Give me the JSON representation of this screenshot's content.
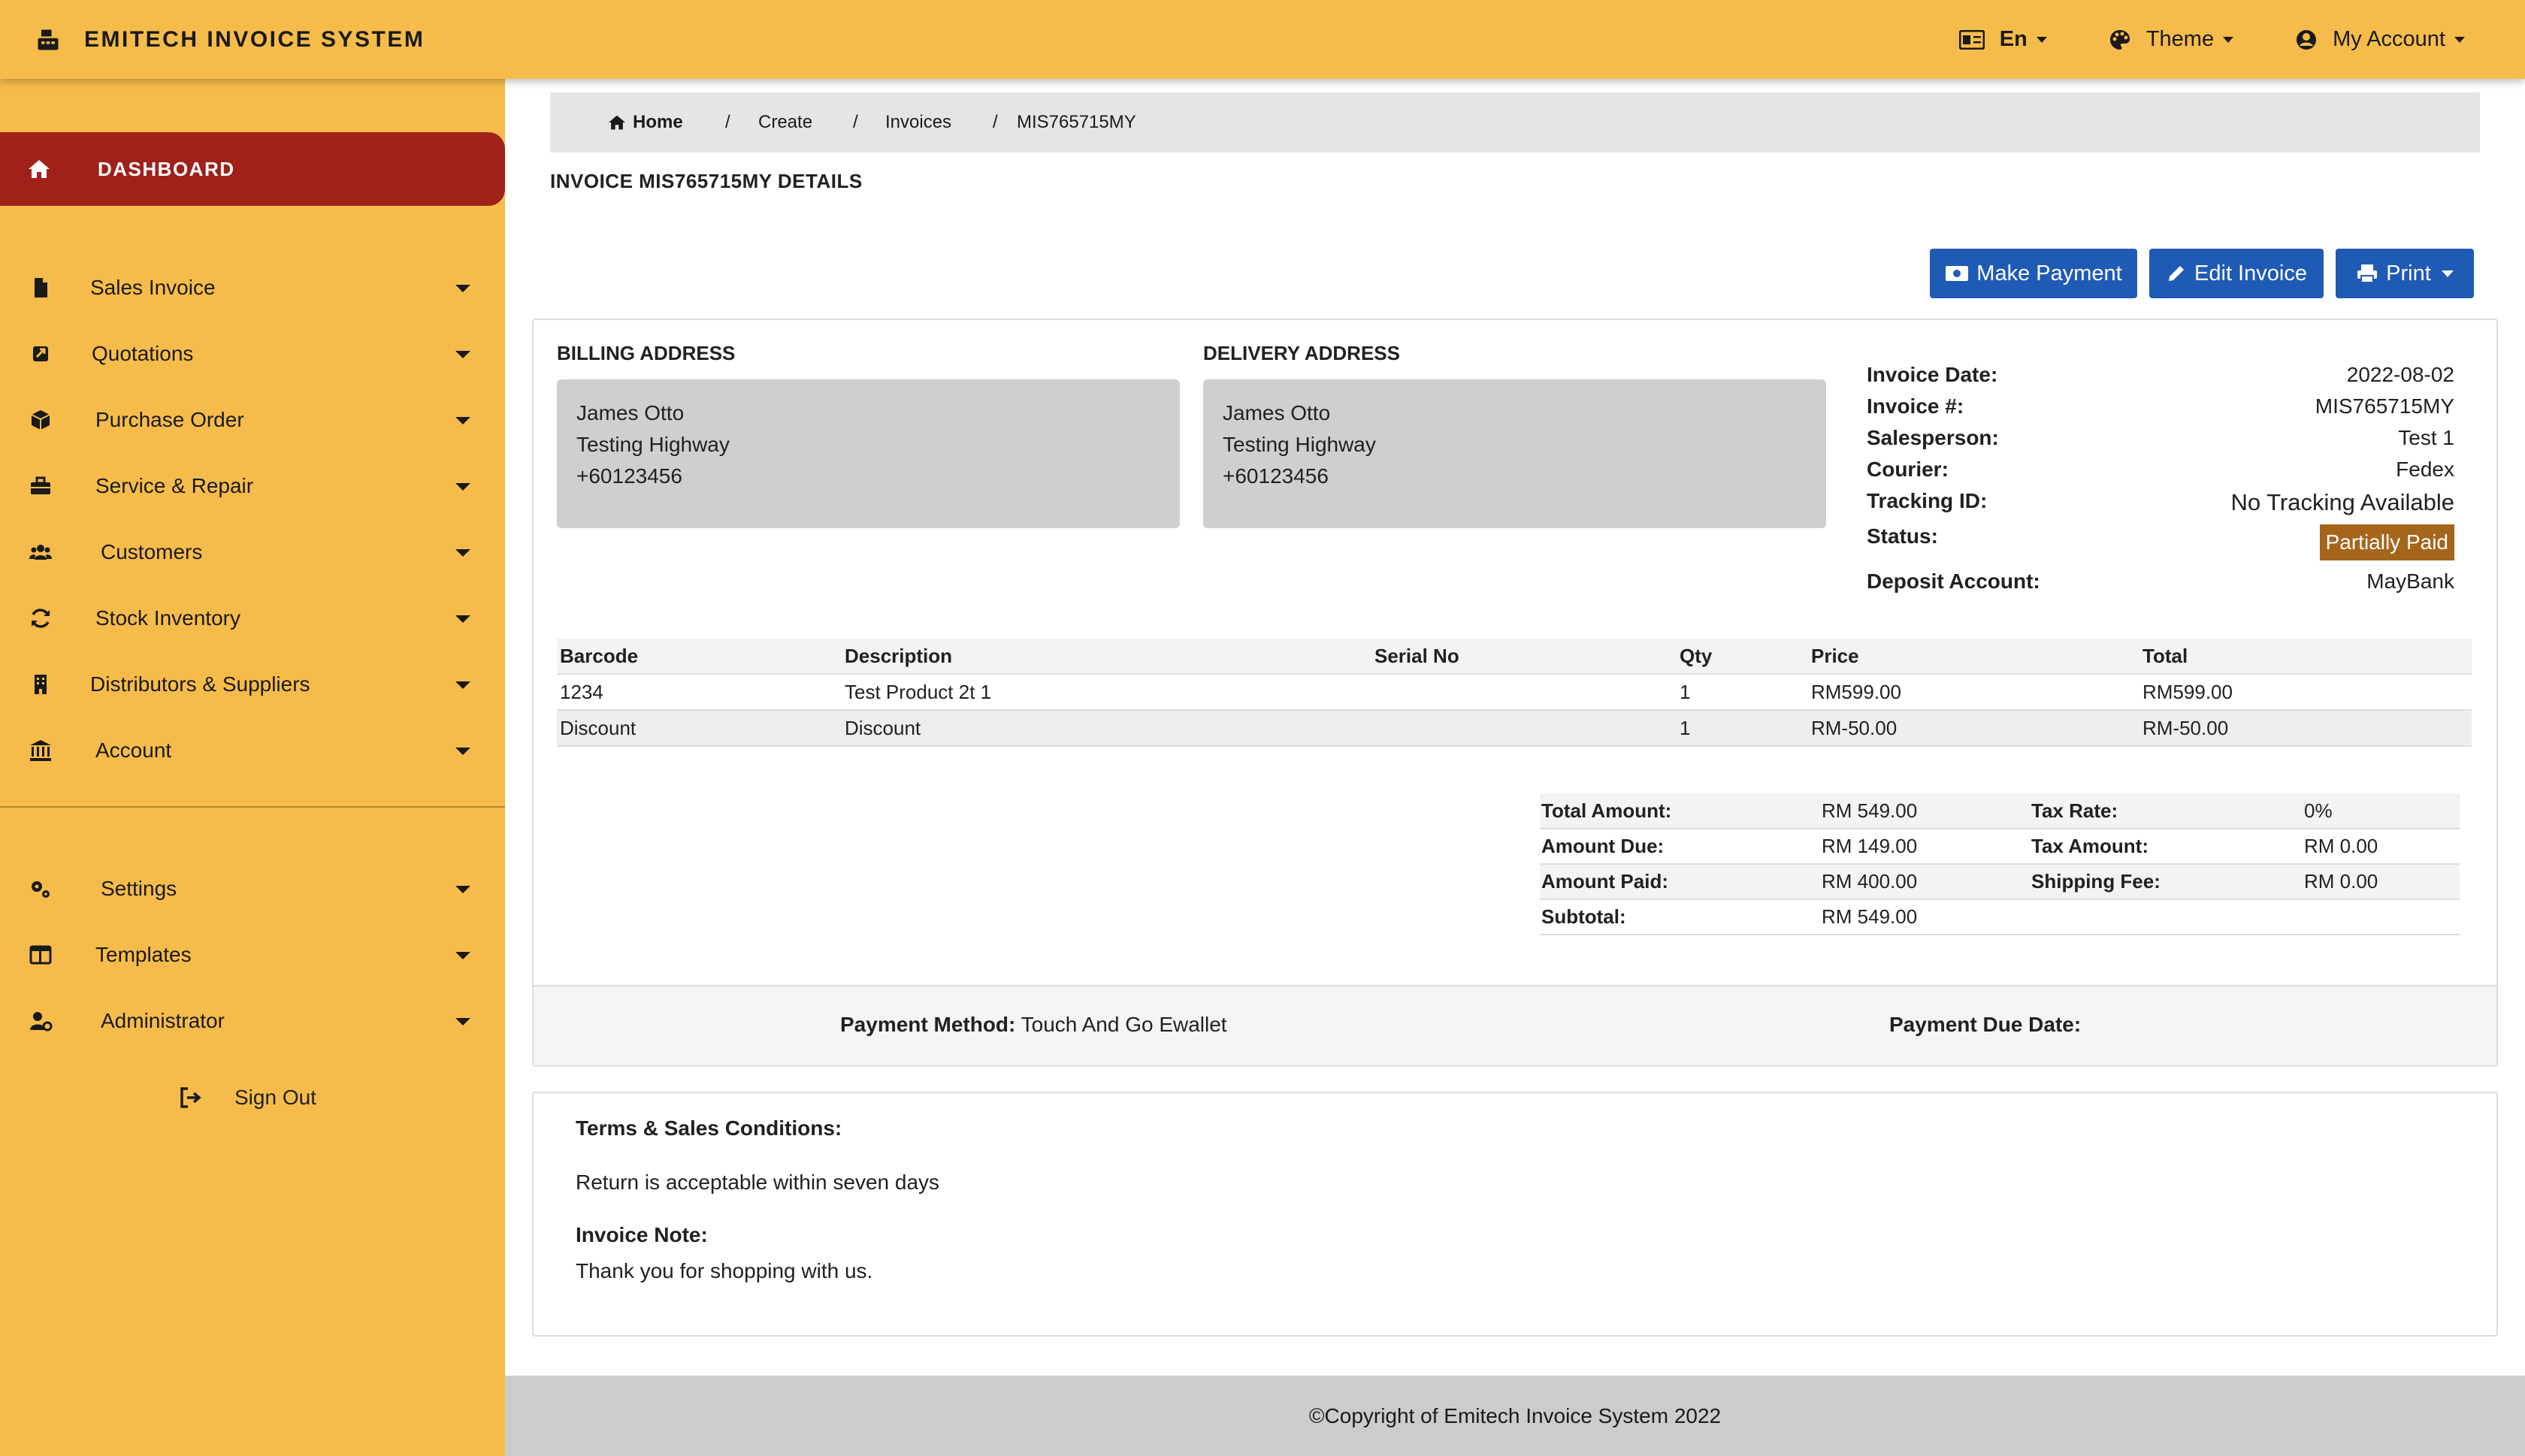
{
  "app": {
    "title": "EMITECH INVOICE SYSTEM"
  },
  "topbar": {
    "language": "En",
    "theme": "Theme",
    "account": "My Account"
  },
  "sidebar": {
    "dashboard": "DASHBOARD",
    "items": [
      {
        "label": "Sales Invoice",
        "icon": "file-icon"
      },
      {
        "label": "Quotations",
        "icon": "quote-icon"
      },
      {
        "label": "Purchase Order",
        "icon": "box-icon"
      },
      {
        "label": "Service & Repair",
        "icon": "toolbox-icon"
      },
      {
        "label": "Customers",
        "icon": "users-icon"
      },
      {
        "label": "Stock Inventory",
        "icon": "sync-icon"
      },
      {
        "label": "Distributors & Suppliers",
        "icon": "building-icon"
      },
      {
        "label": "Account",
        "icon": "bank-icon"
      },
      {
        "label": "Settings",
        "icon": "gears-icon"
      },
      {
        "label": "Templates",
        "icon": "layout-icon"
      },
      {
        "label": "Administrator",
        "icon": "user-cog-icon"
      }
    ],
    "signout": "Sign Out"
  },
  "breadcrumb": {
    "home": "Home",
    "sep": "/",
    "create": "Create",
    "invoices": "Invoices",
    "current": "MIS765715MY"
  },
  "page": {
    "title": "INVOICE MIS765715MY DETAILS"
  },
  "actions": {
    "make_payment": "Make Payment",
    "edit_invoice": "Edit Invoice",
    "print": "Print"
  },
  "billing": {
    "heading": "BILLING ADDRESS",
    "name": "James Otto",
    "street": "Testing Highway",
    "phone": "+60123456"
  },
  "delivery": {
    "heading": "DELIVERY ADDRESS",
    "name": "James Otto",
    "street": "Testing Highway",
    "phone": "+60123456"
  },
  "meta": {
    "invoice_date_label": "Invoice Date:",
    "invoice_date": "2022-08-02",
    "invoice_no_label": "Invoice #:",
    "invoice_no": "MIS765715MY",
    "salesperson_label": "Salesperson:",
    "salesperson": "Test 1",
    "courier_label": "Courier:",
    "courier": "Fedex",
    "tracking_label": "Tracking ID:",
    "tracking": "No Tracking Available",
    "status_label": "Status:",
    "status": "Partially Paid",
    "status_color": "#a5651a",
    "deposit_label": "Deposit Account:",
    "deposit": "MayBank"
  },
  "items": {
    "headers": {
      "barcode": "Barcode",
      "description": "Description",
      "serial": "Serial No",
      "qty": "Qty",
      "price": "Price",
      "total": "Total"
    },
    "rows": [
      {
        "barcode": "1234",
        "description": "Test Product 2t 1",
        "serial": "",
        "qty": "1",
        "price": "RM599.00",
        "total": "RM599.00"
      },
      {
        "barcode": "Discount",
        "description": "Discount",
        "serial": "",
        "qty": "1",
        "price": "RM-50.00",
        "total": "RM-50.00"
      }
    ]
  },
  "totals": {
    "total_amount_label": "Total Amount:",
    "total_amount": "RM 549.00",
    "tax_rate_label": "Tax Rate:",
    "tax_rate": "0%",
    "amount_due_label": "Amount Due:",
    "amount_due": "RM 149.00",
    "tax_amount_label": "Tax Amount:",
    "tax_amount": "RM 0.00",
    "amount_paid_label": "Amount Paid:",
    "amount_paid": "RM 400.00",
    "shipping_label": "Shipping Fee:",
    "shipping": "RM 0.00",
    "subtotal_label": "Subtotal:",
    "subtotal": "RM 549.00"
  },
  "payment": {
    "method_label": "Payment Method:",
    "method": "Touch And Go Ewallet",
    "due_label": "Payment Due Date:"
  },
  "terms": {
    "heading": "Terms & Sales Conditions:",
    "text": "Return is acceptable within seven days",
    "note_heading": "Invoice Note:",
    "note": "Thank you for shopping with us."
  },
  "footer": {
    "copyright": "©Copyright of Emitech Invoice System 2022"
  },
  "colors": {
    "topbar": "#f6bc4b",
    "sidebar": "#f6bc4b",
    "active": "#a0201a",
    "button": "#1f5bb5"
  }
}
